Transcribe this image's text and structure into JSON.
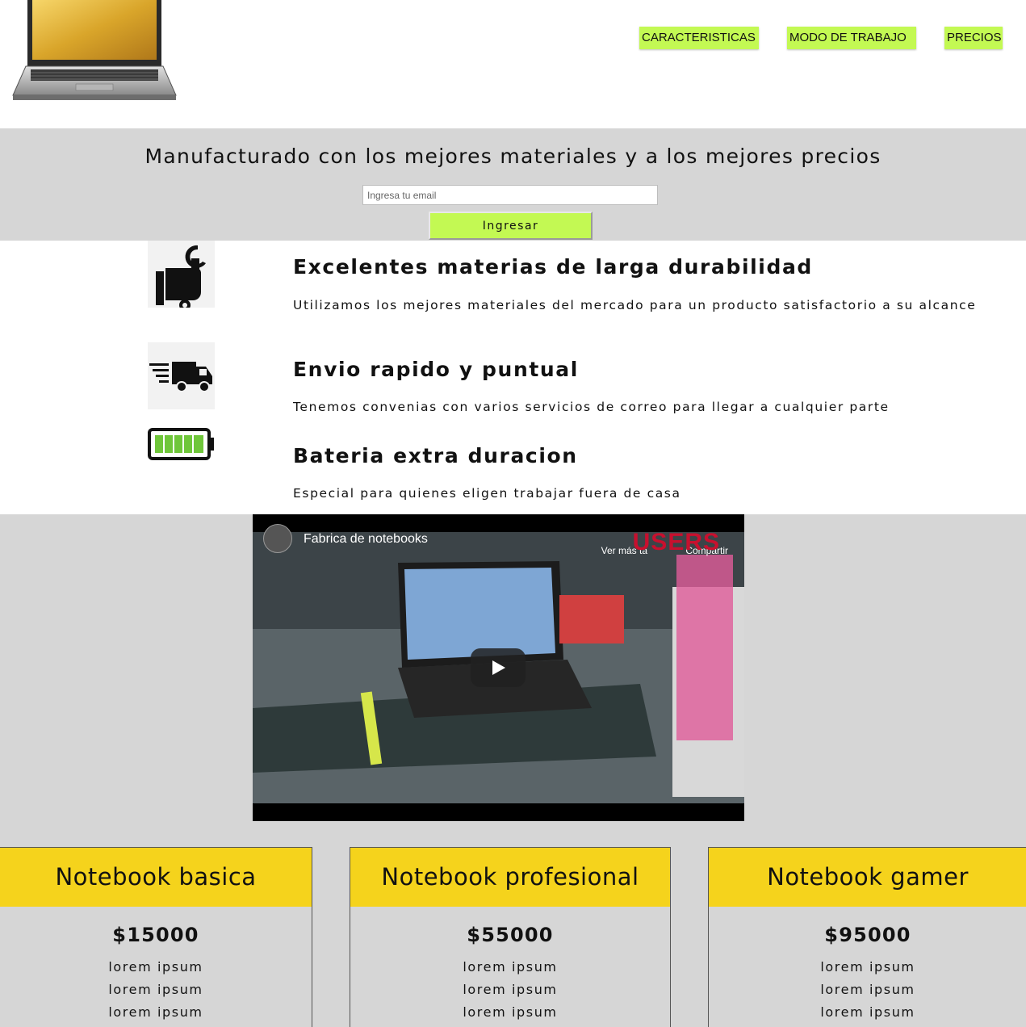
{
  "nav": {
    "features": "CARACTERISTICAS",
    "work_mode": "MODO DE TRABAJO",
    "prices": "PRECIOS"
  },
  "hero": {
    "title": "Manufacturado con los mejores materiales y a los mejores precios",
    "email_placeholder": "Ingresa tu email",
    "submit_label": "Ingresar"
  },
  "features": [
    {
      "icon": "wrench-hand-icon",
      "title": "Excelentes materias de larga durabilidad",
      "text": "Utilizamos los mejores materiales del mercado para un producto satisfactorio a su alcance"
    },
    {
      "icon": "delivery-truck-icon",
      "title": "Envio rapido y puntual",
      "text": "Tenemos convenias con varios servicios de correo para llegar a cualquier parte"
    },
    {
      "icon": "battery-icon",
      "title": "Bateria extra duracion",
      "text": "Especial para quienes eligen trabajar fuera de casa"
    }
  ],
  "video": {
    "title": "Fabrica de notebooks",
    "watch_later": "Ver más ta",
    "share": "Compartir",
    "watermark": "USERS"
  },
  "plans": [
    {
      "name": "Notebook basica",
      "price": "$15000",
      "features": [
        "lorem ipsum",
        "lorem ipsum",
        "lorem ipsum"
      ]
    },
    {
      "name": "Notebook profesional",
      "price": "$55000",
      "features": [
        "lorem ipsum",
        "lorem ipsum",
        "lorem ipsum"
      ]
    },
    {
      "name": "Notebook gamer",
      "price": "$95000",
      "features": [
        "lorem ipsum",
        "lorem ipsum",
        "lorem ipsum"
      ]
    }
  ],
  "colors": {
    "accent_green": "#c3f953",
    "plan_header_yellow": "#f5d31c",
    "section_gray": "#d6d6d6"
  }
}
